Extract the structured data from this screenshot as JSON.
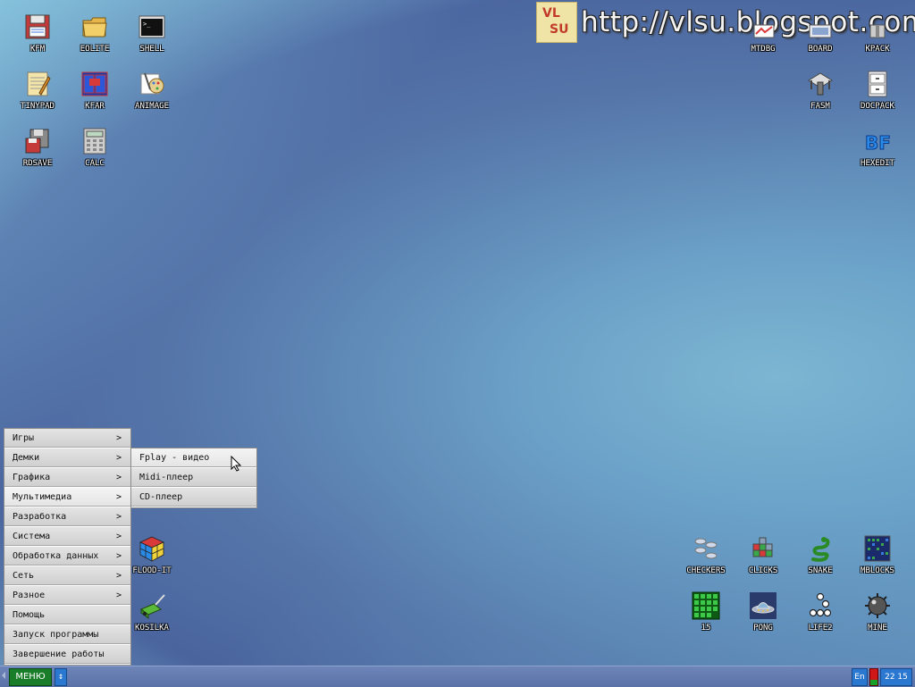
{
  "watermark": {
    "logo_lines": [
      "VL",
      "SU"
    ],
    "url": "http://vlsu.blogspot.com"
  },
  "desktop_icons": {
    "kfm": "KFM",
    "eolite": "EOLITE",
    "shell": "SHELL",
    "tinypad": "TINYPAD",
    "kfar": "KFAR",
    "animage": "ANIMAGE",
    "rdsave": "RDSAVE",
    "calc": "CALC",
    "mtdbg": "MTDBG",
    "board": "BOARD",
    "kpack": "KPACK",
    "fasm": "FASM",
    "docpack": "DOCPACK",
    "hexedit": "HEXEDIT",
    "flood_it": "FLOOD-IT",
    "kosilka": "KOSILKA",
    "checkers": "CHECKERS",
    "clicks": "CLICKS",
    "snake": "SNAKE",
    "mblocks": "MBLOCKS",
    "fifteen": "15",
    "pong": "PONG",
    "life2": "LIFE2",
    "mine": "MINE"
  },
  "main_menu": {
    "items": [
      {
        "label": "Игры",
        "arrow": ">"
      },
      {
        "label": "Демки",
        "arrow": ">"
      },
      {
        "label": "Графика",
        "arrow": ">"
      },
      {
        "label": "Мультимедиа",
        "arrow": ">"
      },
      {
        "label": "Разработка",
        "arrow": ">"
      },
      {
        "label": "Система",
        "arrow": ">"
      },
      {
        "label": "Обработка данных",
        "arrow": ">"
      },
      {
        "label": "Сеть",
        "arrow": ">"
      },
      {
        "label": "Разное",
        "arrow": ">"
      },
      {
        "label": "Помощь",
        "arrow": ""
      },
      {
        "label": "Запуск программы",
        "arrow": ""
      },
      {
        "label": "Завершение работы",
        "arrow": ""
      }
    ]
  },
  "submenu_multimedia": {
    "items": [
      "Fplay - видео",
      "Midi-плеер",
      "CD-плеер"
    ]
  },
  "taskbar": {
    "start_label": "МЕНЮ",
    "toggle_glyph": "↕",
    "lang": "En",
    "mem_fill_fraction": 0.35,
    "clock": "22 15"
  },
  "colors": {
    "start_green": "#1a7d2a",
    "taskbar_blue": "#2a78d0",
    "menu_bg": "#d4d4d4"
  }
}
